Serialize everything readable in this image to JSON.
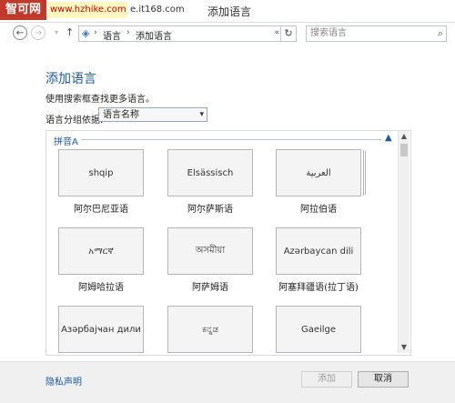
{
  "watermark": {
    "text": "智可网",
    "url": "www.hzhike.com",
    "url_overlay": "e.it168.com"
  },
  "window": {
    "title": "添加语言"
  },
  "nav": {
    "back_icon": "back-arrow-icon",
    "forward_icon": "forward-arrow-icon",
    "breadcrumb": [
      "语言",
      "添加语言"
    ],
    "search_placeholder": "搜索语言"
  },
  "page": {
    "title": "添加语言",
    "description": "使用搜索框查找更多语言。",
    "group_by_label": "语言分组依据:",
    "group_by_value": "语言名称"
  },
  "section": {
    "header": "拼音A"
  },
  "languages": [
    {
      "native": "shqip",
      "label": "阿尔巴尼亚语"
    },
    {
      "native": "Elsässisch",
      "label": "阿尔萨斯语"
    },
    {
      "native": "العربية",
      "label": "阿拉伯语"
    },
    {
      "native": "አማርኛ",
      "label": "阿姆哈拉语"
    },
    {
      "native": "অসমীয়া",
      "label": "阿萨姆语"
    },
    {
      "native": "Azərbaycan dili",
      "label": "阿塞拜疆语(拉丁语)"
    },
    {
      "native": "Азәрбајҹан дили",
      "label": ""
    },
    {
      "native": "ಕನ್ನಡ",
      "label": ""
    },
    {
      "native": "Gaeilge",
      "label": ""
    }
  ],
  "footer": {
    "privacy": "隐私声明",
    "add": "添加",
    "cancel": "取消"
  }
}
